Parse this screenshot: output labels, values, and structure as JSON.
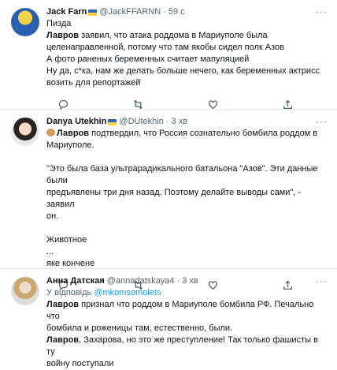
{
  "tweets": [
    {
      "name": "Jack Farn",
      "handle": "@JackFFARNN",
      "time": "59 с",
      "lines": [
        "Пизда",
        "Лавров заявил, что атака роддома в Мариуполе была",
        "целенаправленной, потому что там якобы сидел полк Азов",
        "А фото раненых беременных считает мапуляцией",
        "Ну да, с*ка, нам же делать больше нечего, как беременных актрисс",
        "возить для репортажей"
      ]
    },
    {
      "name": "Danya Utekhin",
      "handle": "@DUtekhin",
      "time": "3 хв",
      "lines": [
        "Лавров подтвердил, что Россия сознательно бомбила роддом в",
        "Мариуполе.",
        "",
        "\"Это была база ультрарадикального батальона \"Азов\". Эти данные были",
        "предъявлены три дня назад. Поэтому делайте выводы сами\", - заявил",
        "он.",
        "",
        "Животное",
        "...",
        "яке кончене"
      ]
    },
    {
      "name": "Анна Датская",
      "handle": "@annadatskaya4",
      "time": "3 хв",
      "reply_prefix": "У відповідь",
      "reply_to": "@mkomsomolets",
      "lines": [
        "Лавров признал что роддом в Мариуполе бомбила РФ. Печально что",
        "бомбила и роженицы там, естественно, были.",
        "Лавров, Захарова, но это же преступление! Так только фашисты в ту",
        "войну поступали"
      ]
    }
  ],
  "bold_word": "Лавров",
  "icons": [
    "reply-icon",
    "retweet-icon",
    "like-icon",
    "share-icon",
    "more-icon"
  ]
}
